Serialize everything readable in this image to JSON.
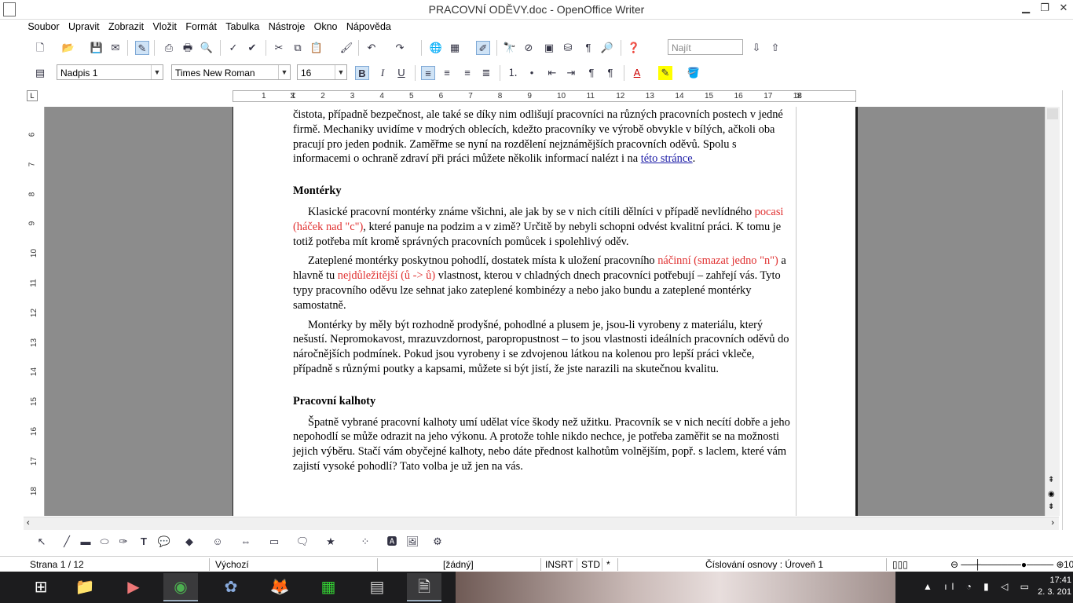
{
  "window": {
    "title": "PRACOVNÍ ODĚVY.doc - OpenOffice Writer",
    "minimize": "▁",
    "restore": "❐",
    "close": "✕"
  },
  "menu": [
    "Soubor",
    "Upravit",
    "Zobrazit",
    "Vložit",
    "Formát",
    "Tabulka",
    "Nástroje",
    "Okno",
    "Nápověda"
  ],
  "toolbar1": {
    "find_placeholder": "Najít"
  },
  "toolbar2": {
    "style": "Nadpis 1",
    "font": "Times New Roman",
    "size": "16",
    "bold": "B",
    "italic": "I",
    "underline": "U"
  },
  "ruler_h": [
    "1",
    "1",
    "2",
    "3",
    "4",
    "5",
    "6",
    "7",
    "8",
    "9",
    "10",
    "11",
    "12",
    "13",
    "14",
    "15",
    "16",
    "17",
    "18"
  ],
  "ruler_v": [
    "6",
    "7",
    "8",
    "9",
    "10",
    "11",
    "12",
    "13",
    "14",
    "15",
    "16",
    "17",
    "18"
  ],
  "document": {
    "intro_a": "čistota, případně bezpečnost, ale také se díky nim odlišují pracovníci na různých pracovních postech v jedné firmě. Mechaniky uvidíme v modrých oblecích, kdežto pracovníky ve výrobě obvykle v bílých, ačkoli oba pracují pro jeden podnik. Zaměřme se nyní na rozdělení nejznámějších pracovních oděvů. Spolu s informacemi o ochraně zdraví při práci můžete několik informací nalézt i na ",
    "intro_link": "této stránce",
    "intro_end": ".",
    "h1": "Montérky",
    "p1_a": "Klasické pracovní montérky známe všichni, ale jak by se v nich cítili dělníci v případě nevlídného ",
    "p1_red": "pocasi (háček nad \"c\")",
    "p1_b": ", které panuje na podzim a v zimě? Určitě by nebyli schopni odvést kvalitní práci. K tomu je totiž potřeba mít kromě správných pracovních pomůcek i spolehlivý oděv.",
    "p2_a": "Zateplené montérky poskytnou pohodlí, dostatek místa k uložení pracovního ",
    "p2_red1": "náčinní (smazat jedno \"n\")",
    "p2_b": " a hlavně tu ",
    "p2_red2": "nejdůležitější (ů -> ů)",
    "p2_c": " vlastnost, kterou v chladných dnech pracovníci potřebují – zahřejí vás. Tyto typy pracovního oděvu lze sehnat jako zateplené kombinézy a nebo jako bundu a zateplené montérky samostatně.",
    "p3": "Montérky by měly být rozhodně prodyšné, pohodlné a plusem je, jsou-li vyrobeny z materiálu, který nešustí. Nepromokavost, mrazuvzdornost, paropropustnost – to jsou vlastnosti ideálních pracovních oděvů do náročnějších podmínek. Pokud jsou vyrobeny i se zdvojenou látkou na kolenou pro lepší práci vkleče, případně s různými poutky a kapsami, můžete si být jistí, že jste narazili na skutečnou kvalitu.",
    "h2": "Pracovní kalhoty",
    "p4": "Špatně vybrané pracovní kalhoty umí udělat více škody než užitku. Pracovník se v nich necítí dobře a jeho nepohodlí se může odrazit na jeho výkonu. A protože tohle nikdo nechce, je potřeba zaměřit se na možnosti jejich výběru. Stačí vám obyčejné kalhoty, nebo dáte přednost kalhotům volnějším, popř. s laclem, které vám zajistí vysoké pohodlí? Tato volba je už jen na vás."
  },
  "status": {
    "page": "Strana 1 / 12",
    "style": "Výchozí",
    "lang": "[žádný]",
    "insrt": "INSRT",
    "std": "STD",
    "star": "*",
    "outline": "Číslování osnovy : Úroveň 1",
    "zoom": "10"
  },
  "taskbar": {
    "time": "17:41",
    "date": "2. 3. 201"
  },
  "colors": {
    "accent_red": "#e03030",
    "link": "#1a1aa6",
    "workspace": "#8c8c8c"
  }
}
